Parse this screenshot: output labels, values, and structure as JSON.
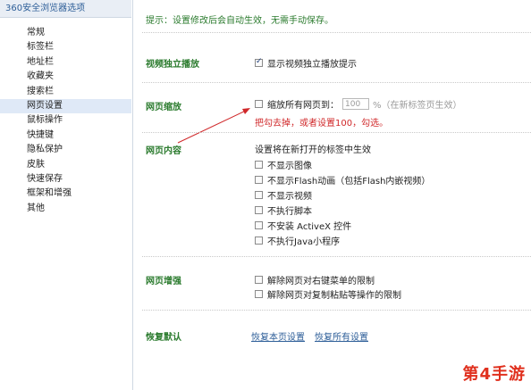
{
  "sidebar": {
    "title": "360安全浏览器选项",
    "items": [
      {
        "label": "常规"
      },
      {
        "label": "标签栏"
      },
      {
        "label": "地址栏"
      },
      {
        "label": "收藏夹"
      },
      {
        "label": "搜索栏"
      },
      {
        "label": "网页设置",
        "active": true
      },
      {
        "label": "鼠标操作"
      },
      {
        "label": "快捷键"
      },
      {
        "label": "隐私保护"
      },
      {
        "label": "皮肤"
      },
      {
        "label": "快速保存"
      },
      {
        "label": "框架和增强"
      },
      {
        "label": "其他"
      }
    ]
  },
  "main": {
    "hint": "提示：设置修改后会自动生效，无需手动保存。",
    "video": {
      "label": "视频独立播放",
      "option": "显示视频独立播放提示",
      "checked": true
    },
    "zoom": {
      "label": "网页缩放",
      "option": "缩放所有网页到：",
      "value": "100",
      "suffix": "%（在新标签页生效）",
      "annotation": "把勾去掉，或者设置100，勾选。"
    },
    "content": {
      "label": "网页内容",
      "heading": "设置将在新打开的标签中生效",
      "options": [
        "不显示图像",
        "不显示Flash动画（包括Flash内嵌视频）",
        "不显示视频",
        "不执行脚本",
        "不安装 ActiveX 控件",
        "不执行Java小程序"
      ]
    },
    "enhance": {
      "label": "网页增强",
      "options": [
        "解除网页对右键菜单的限制",
        "解除网页对复制粘贴等操作的限制"
      ]
    },
    "restore": {
      "label": "恢复默认",
      "link_page": "恢复本页设置",
      "link_all": "恢复所有设置"
    }
  },
  "watermark": "第4手游",
  "colors": {
    "section_green": "#2b7b2e",
    "link_blue": "#2d5e98",
    "annotation_red": "#d0282a",
    "active_bg": "#dfe9f7"
  }
}
